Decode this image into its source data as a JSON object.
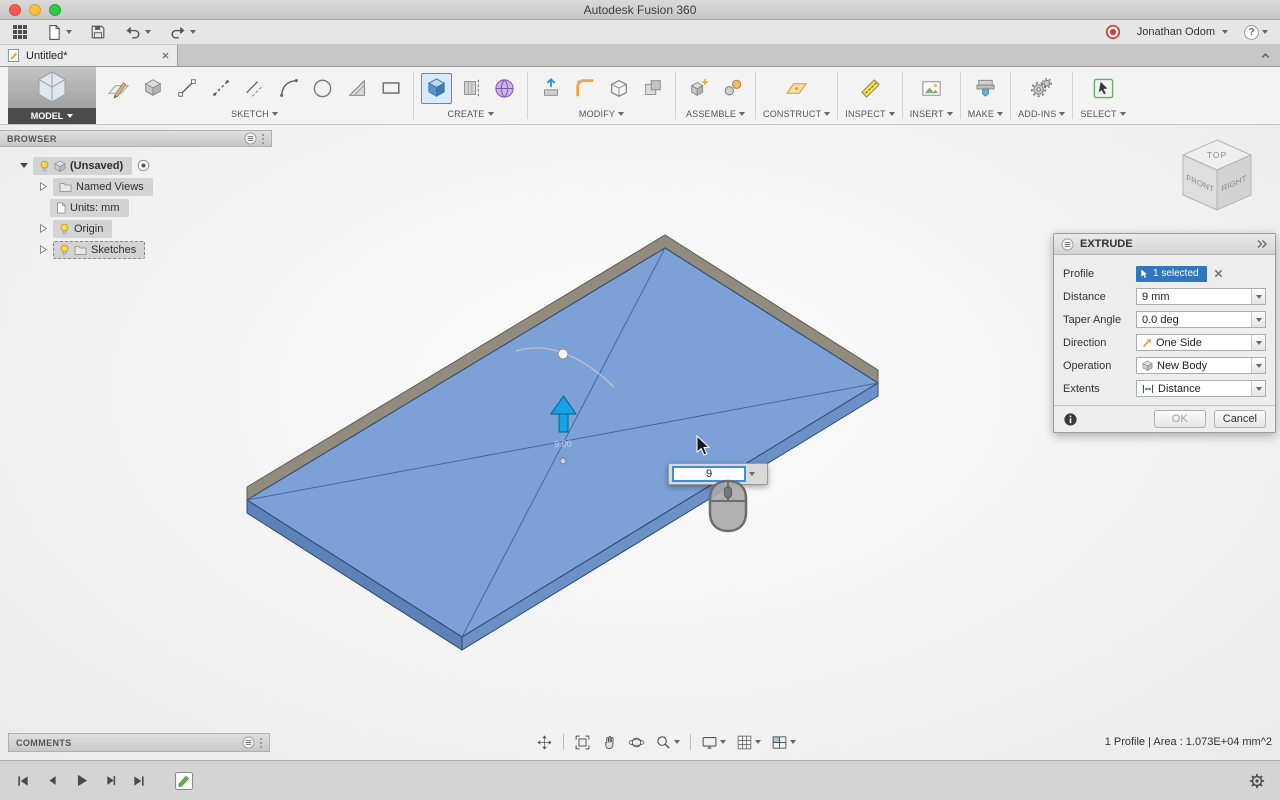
{
  "window": {
    "title": "Autodesk Fusion 360"
  },
  "app_toolbar": {
    "user_name": "Jonathan Odom",
    "help_glyph": "?"
  },
  "tab_bar": {
    "active_tab_title": "Untitled*"
  },
  "ribbon": {
    "model_label": "MODEL",
    "sketch_label": "SKETCH",
    "create_label": "CREATE",
    "modify_label": "MODIFY",
    "assemble_label": "ASSEMBLE",
    "construct_label": "CONSTRUCT",
    "inspect_label": "INSPECT",
    "insert_label": "INSERT",
    "make_label": "MAKE",
    "addins_label": "ADD-INS",
    "select_label": "SELECT"
  },
  "browser_panel": {
    "title": "BROWSER",
    "root_label": "(Unsaved)",
    "named_views": "Named Views",
    "units": "Units: mm",
    "origin": "Origin",
    "sketches": "Sketches"
  },
  "viewcube": {
    "top": "TOP",
    "front": "FRONT",
    "right": "RIGHT"
  },
  "extrude_dialog": {
    "title": "EXTRUDE",
    "fields": [
      {
        "label": "Profile",
        "value": "1 selected"
      },
      {
        "label": "Distance",
        "value": "9 mm"
      },
      {
        "label": "Taper Angle",
        "value": "0.0 deg"
      },
      {
        "label": "Direction",
        "value": "One Side"
      },
      {
        "label": "Operation",
        "value": "New Body"
      },
      {
        "label": "Extents",
        "value": "Distance"
      }
    ],
    "ok_label": "OK",
    "cancel_label": "Cancel"
  },
  "viewport": {
    "dimension_value": "9",
    "manipulator_label": "9.00"
  },
  "status_bar": {
    "comments_label": "COMMENTS",
    "selection_info": "1 Profile | Area : 1.073E+04 mm^2"
  },
  "colors": {
    "accent_blue": "#2f8ad2",
    "body_top_face": "#7ba1d7",
    "body_side_face": "#5d82b8",
    "back_band": "#918c7e",
    "selection_badge": "#2f76bd"
  }
}
